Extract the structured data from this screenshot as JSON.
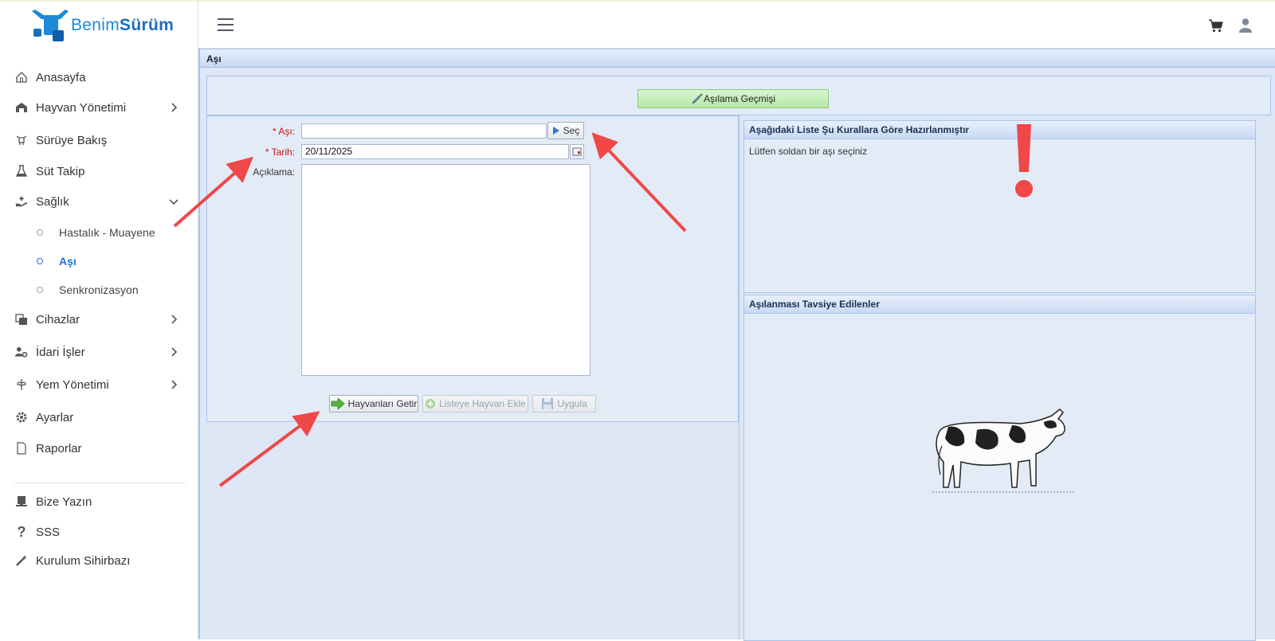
{
  "app": {
    "logo_prefix": "Benim",
    "logo_suffix": "Sürüm"
  },
  "sidebar": {
    "items": [
      {
        "label": "Anasayfa",
        "icon": "home-icon"
      },
      {
        "label": "Hayvan Yönetimi",
        "icon": "barn-icon"
      },
      {
        "label": "Sürüye Bakış",
        "icon": "herd-icon"
      },
      {
        "label": "Süt Takip",
        "icon": "flask-icon"
      },
      {
        "label": "Sağlık",
        "icon": "health-hand-icon"
      },
      {
        "label": "Cihazlar",
        "icon": "devices-icon"
      },
      {
        "label": "İdari İşler",
        "icon": "user-cog-icon"
      },
      {
        "label": "Yem Yönetimi",
        "icon": "feed-icon"
      },
      {
        "label": "Ayarlar",
        "icon": "gear-icon"
      },
      {
        "label": "Raporlar",
        "icon": "document-icon"
      }
    ],
    "health_sub": [
      {
        "label": "Hastalık - Muayene"
      },
      {
        "label": "Aşı"
      },
      {
        "label": "Senkronizasyon"
      }
    ],
    "bottom": [
      {
        "label": "Bize Yazın",
        "icon": "message-icon"
      },
      {
        "label": "SSS",
        "icon": "question-icon"
      },
      {
        "label": "Kurulum Sihirbazı",
        "icon": "wand-icon"
      }
    ]
  },
  "main": {
    "title": "Aşı",
    "history_button": "Aşılama Geçmişi",
    "form": {
      "vaccine_label": "* Aşı:",
      "vaccine_value": "",
      "select_button": "Seç",
      "date_label": "* Tarih:",
      "date_value": "20/11/2025",
      "note_label": "Açıklama:",
      "note_value": ""
    },
    "buttons": {
      "get_animals": "Hayvanları Getir",
      "add_to_list": "Listeye Hayvan Ekle",
      "apply": "Uygula"
    },
    "rules_panel": {
      "title": "Aşağıdaki Liste Şu Kurallara Göre Hazırlanmıştır",
      "text": "Lütfen soldan bir aşı seçiniz"
    },
    "recommended_panel": {
      "title": "Aşılanması Tavsiye Edilenler"
    }
  },
  "colors": {
    "accent": "#1c75d1",
    "panel_bg": "#dde7f5",
    "required": "#cc1111",
    "annotation": "#f04848"
  }
}
